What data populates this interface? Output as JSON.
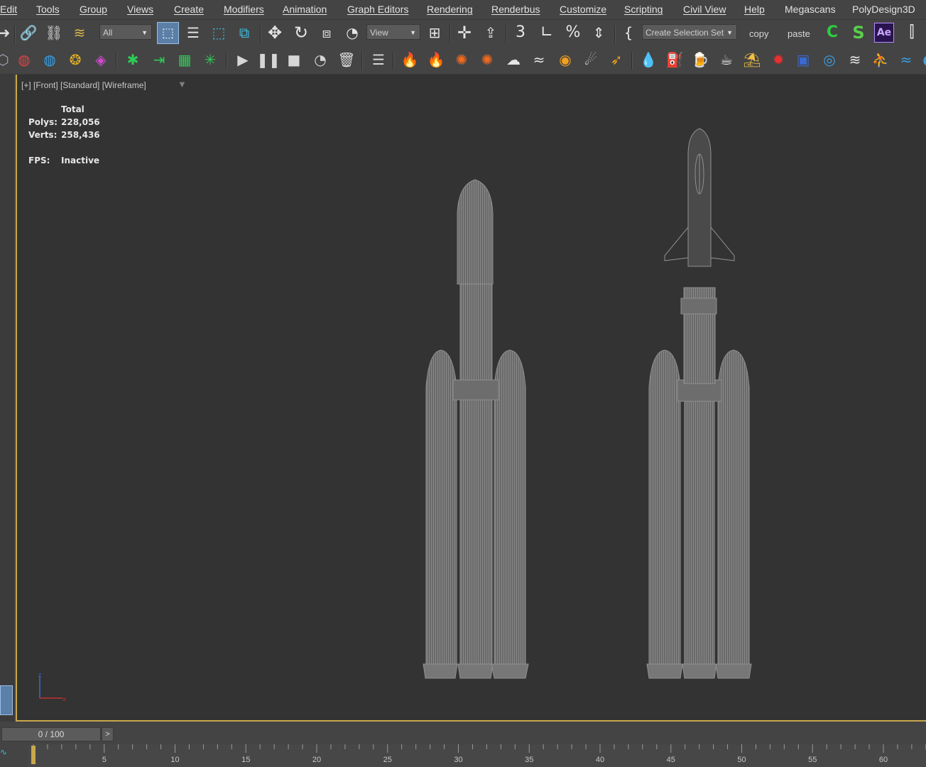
{
  "menu": [
    "Edit",
    "Tools",
    "Group",
    "Views",
    "Create",
    "Modifiers",
    "Animation",
    "Graph Editors",
    "Rendering",
    "Renderbus",
    "Customize",
    "Scripting",
    "Civil View",
    "Help",
    "Megascans",
    "PolyDesign3D"
  ],
  "toolbar": {
    "filter_dropdown": "All",
    "reference_coord_dropdown": "View",
    "selection_set_dropdown": "Create Selection Se​t",
    "copy_label": "copy",
    "paste_label": "paste"
  },
  "viewport": {
    "label": "[+] [Front] [Standard] [Wireframe]",
    "stats_header": "Total",
    "polys_label": "Polys:",
    "polys_value": "228,056",
    "verts_label": "Verts:",
    "verts_value": "258,436",
    "fps_label": "FPS:",
    "fps_value": "Inactive"
  },
  "timeline": {
    "slider_text": "0 / 100",
    "next_label": ">",
    "current_frame": 0,
    "ruler_labels": [
      "5",
      "10",
      "15",
      "20",
      "25",
      "30",
      "35",
      "40",
      "45",
      "50",
      "55",
      "60"
    ]
  },
  "colors": {
    "accent_gold": "#c8a84a",
    "viewport_bg": "#333333",
    "ui_bg": "#444444",
    "wire": "#8a8a8a"
  }
}
